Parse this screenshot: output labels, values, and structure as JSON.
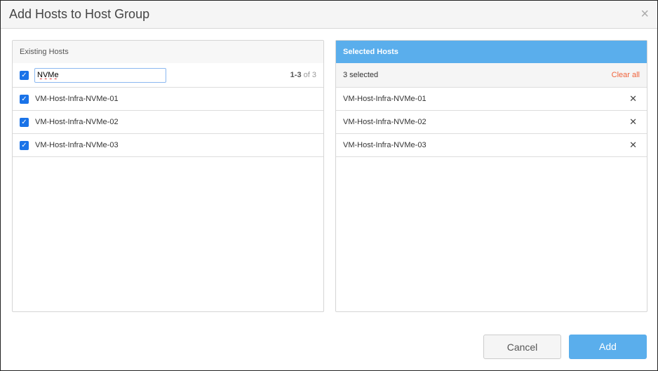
{
  "dialog": {
    "title": "Add Hosts to Host Group",
    "close_icon": "×"
  },
  "existing": {
    "header": "Existing Hosts",
    "search_value": "NVMe",
    "range": "1-3",
    "of": "of 3",
    "hosts": [
      {
        "name": "VM-Host-Infra-NVMe-01",
        "checked": true
      },
      {
        "name": "VM-Host-Infra-NVMe-02",
        "checked": true
      },
      {
        "name": "VM-Host-Infra-NVMe-03",
        "checked": true
      }
    ]
  },
  "selected": {
    "header": "Selected Hosts",
    "count": "3 selected",
    "clear_all": "Clear all",
    "hosts": [
      "VM-Host-Infra-NVMe-01",
      "VM-Host-Infra-NVMe-02",
      "VM-Host-Infra-NVMe-03"
    ]
  },
  "buttons": {
    "cancel": "Cancel",
    "add": "Add"
  },
  "colors": {
    "accent": "#5aaeec",
    "clear": "#f0643c",
    "checkbox": "#1a73e8"
  }
}
